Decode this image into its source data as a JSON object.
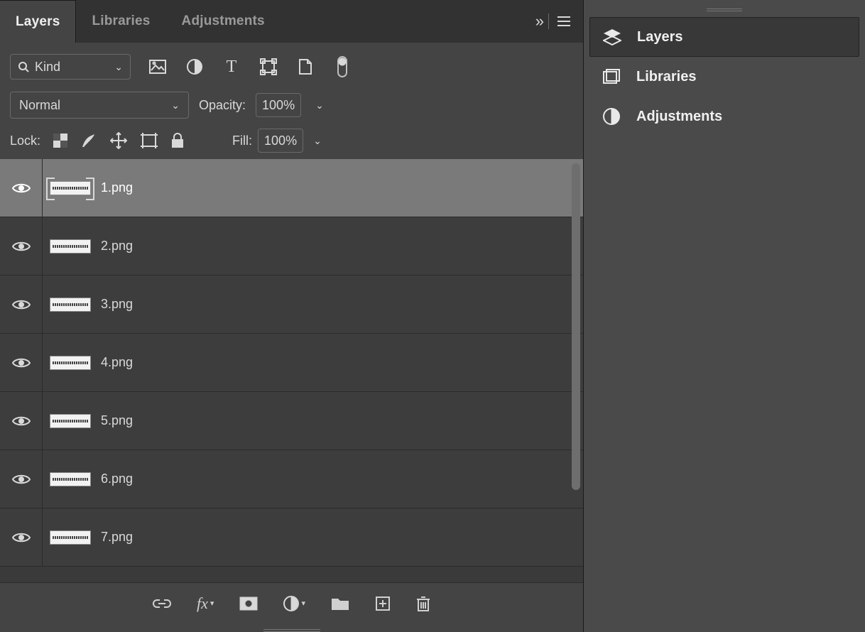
{
  "tabs": {
    "layers": "Layers",
    "libraries": "Libraries",
    "adjustments": "Adjustments"
  },
  "filter": {
    "kind_label": "Kind"
  },
  "blend": {
    "mode": "Normal",
    "opacity_label": "Opacity:",
    "opacity_value": "100%"
  },
  "lock": {
    "label": "Lock:",
    "fill_label": "Fill:",
    "fill_value": "100%"
  },
  "layers": [
    {
      "name": "1.png",
      "selected": true
    },
    {
      "name": "2.png",
      "selected": false
    },
    {
      "name": "3.png",
      "selected": false
    },
    {
      "name": "4.png",
      "selected": false
    },
    {
      "name": "5.png",
      "selected": false
    },
    {
      "name": "6.png",
      "selected": false
    },
    {
      "name": "7.png",
      "selected": false
    }
  ],
  "side": {
    "layers": "Layers",
    "libraries": "Libraries",
    "adjustments": "Adjustments"
  }
}
